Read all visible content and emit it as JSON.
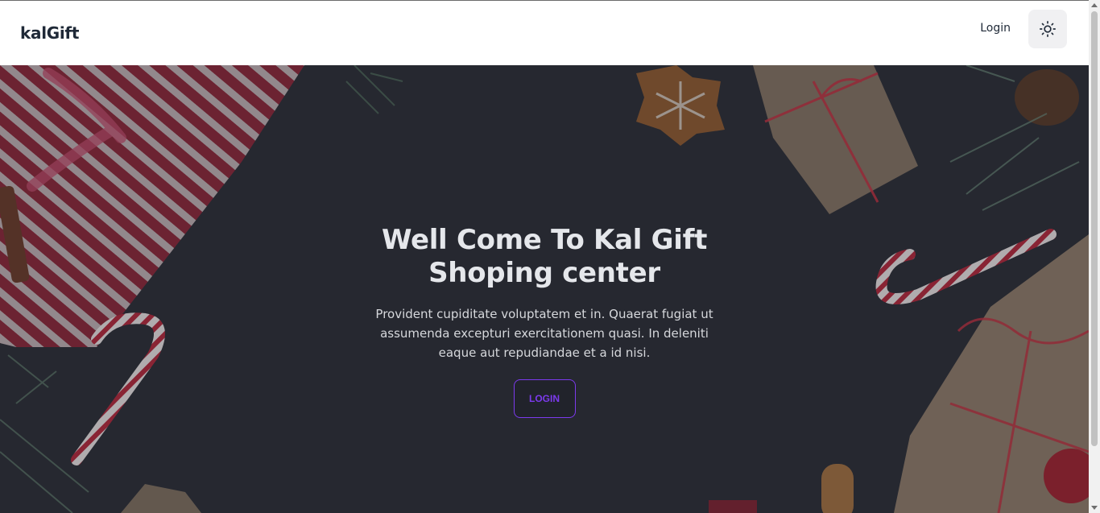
{
  "navbar": {
    "brand": "kalGift",
    "login_label": "Login",
    "theme_icon": "sun-icon"
  },
  "hero": {
    "title": "Well Come To Kal Gift Shoping center",
    "description": "Provident cupiditate voluptatem et in. Quaerat fugiat ut assumenda excepturi exercitationem quasi. In deleniti eaque aut repudiandae et a id nisi.",
    "button_label": "LOGIN"
  },
  "colors": {
    "accent": "#7c3aed",
    "hero_overlay": "#262830",
    "wrapping_red": "#b3263a",
    "kraft_paper": "#a88e72"
  }
}
